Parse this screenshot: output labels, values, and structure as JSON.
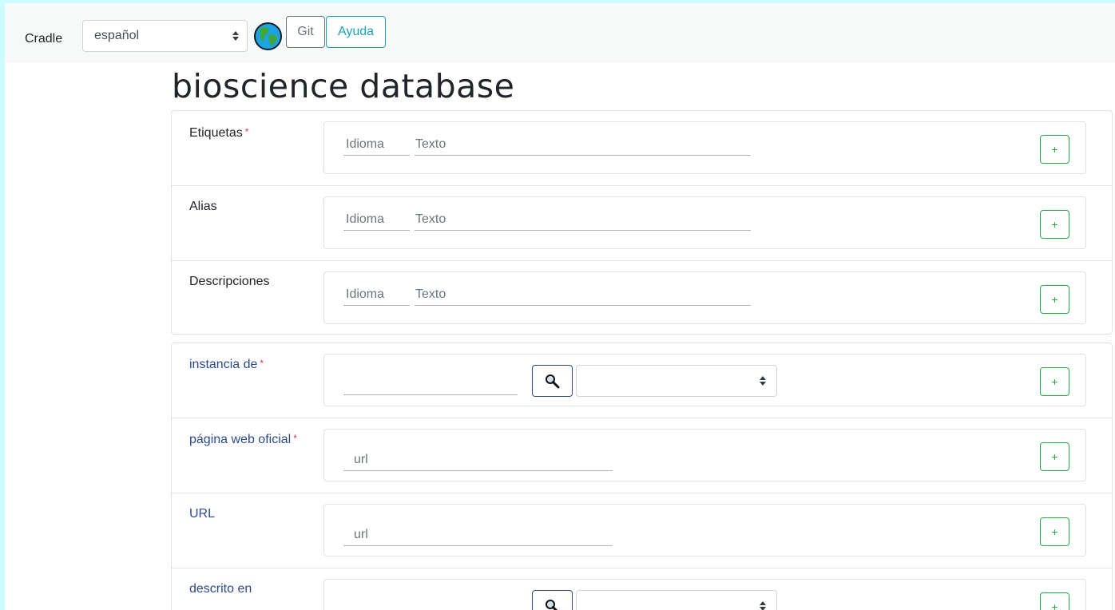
{
  "navbar": {
    "brand": "Cradle",
    "language_select": {
      "value": "español"
    },
    "globe_icon": "globe-icon",
    "git_button": "Git",
    "help_button": "Ayuda"
  },
  "page_title": "bioscience database",
  "terms": [
    {
      "label": "Etiquetas",
      "required": "*",
      "lang_placeholder": "Idioma",
      "text_placeholder": "Texto",
      "add": "+"
    },
    {
      "label": "Alias",
      "required": "",
      "lang_placeholder": "Idioma",
      "text_placeholder": "Texto",
      "add": "+"
    },
    {
      "label": "Descripciones",
      "required": "",
      "lang_placeholder": "Idioma",
      "text_placeholder": "Texto",
      "add": "+"
    }
  ],
  "statements": [
    {
      "label": "instancia de",
      "required": "*",
      "kind": "item",
      "search_icon": "search-icon",
      "select_value": "",
      "add": "+"
    },
    {
      "label": "página web oficial",
      "required": "*",
      "kind": "url",
      "placeholder": "url",
      "add": "+"
    },
    {
      "label": "URL",
      "required": "",
      "kind": "url",
      "placeholder": "url",
      "add": "+"
    },
    {
      "label": "descrito en",
      "required": "",
      "kind": "item",
      "search_icon": "search-icon",
      "select_value": "",
      "add": "+"
    }
  ],
  "colors": {
    "frame_background": "#ccfcff",
    "navbar_background": "#f7f8f8",
    "property_label": "#2c4a8a",
    "required_marker": "#dc3545",
    "add_button": "#28a745",
    "help_button": "#17a2b8"
  }
}
